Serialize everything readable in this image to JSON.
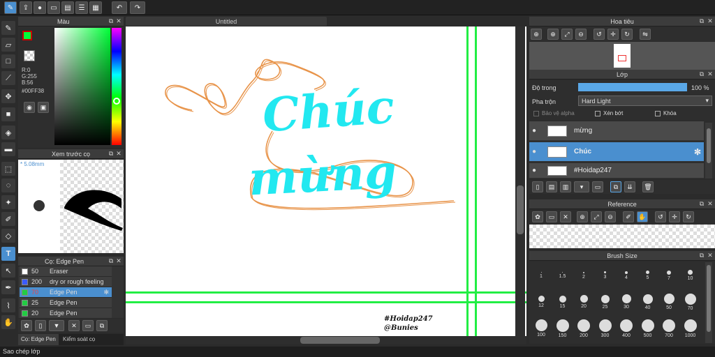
{
  "toolbar": {
    "icons": [
      "mode-icon",
      "export-icon",
      "comment-icon",
      "message-icon",
      "page-icon",
      "list-icon",
      "grid-icon"
    ],
    "undo": "↶",
    "redo": "↷"
  },
  "canvas": {
    "tab_title": "Untitled",
    "art_word1": "Chúc",
    "art_word2": "mừng",
    "signature_line1": "#Hoidap247",
    "signature_line2": "@Bunies",
    "art_color": "#22e8f0",
    "guide_color": "#22ee44",
    "curve_color": "#e8944a"
  },
  "color_panel": {
    "title": "Màu",
    "r": "R:0",
    "g": "G:255",
    "b": "B:56",
    "hex": "#00FF38",
    "current_color": "#00ff38"
  },
  "preview_panel": {
    "title": "Xem trước cọ",
    "size": "5.08mm"
  },
  "brush_panel": {
    "title": "Cọ: Edge Pen",
    "brushes": [
      {
        "size": "50",
        "name": "Eraser",
        "color": "#ffffff",
        "selected": false
      },
      {
        "size": "200",
        "name": "dry or rough feeling",
        "color": "#3b5bff",
        "selected": false
      },
      {
        "size": "70",
        "name": "Edge Pen",
        "color": "#22cc44",
        "selected": true
      },
      {
        "size": "25",
        "name": "Edge Pen",
        "color": "#22cc44",
        "selected": false
      },
      {
        "size": "20",
        "name": "Edge Pen",
        "color": "#22cc44",
        "selected": false
      }
    ],
    "tab1": "Cọ: Edge Pen",
    "tab2": "Kiểm soát cọ"
  },
  "status_bar": {
    "text": "Sao chép lớp"
  },
  "navigator_panel": {
    "title": "Hoa tiêu"
  },
  "layer_panel": {
    "title": "Lớp",
    "opacity_label": "Độ trong",
    "opacity_value": "100 %",
    "opacity_fraction": 1.0,
    "blend_label": "Pha trộn",
    "blend_value": "Hard Light",
    "protect_alpha": "Bảo vệ alpha",
    "clipping": "Xén bớt",
    "lock": "Khóa",
    "layers": [
      {
        "name": "mừng",
        "selected": false
      },
      {
        "name": "Chúc",
        "selected": true
      },
      {
        "name": "#Hoidap247",
        "selected": false
      }
    ]
  },
  "reference_panel": {
    "title": "Reference"
  },
  "brush_size_panel": {
    "title": "Brush Size",
    "sizes": [
      "1",
      "1.5",
      "2",
      "3",
      "4",
      "5",
      "7",
      "10",
      "12",
      "15",
      "20",
      "25",
      "30",
      "40",
      "50",
      "70",
      "100",
      "150",
      "200",
      "300",
      "400",
      "500",
      "700",
      "1000"
    ]
  }
}
